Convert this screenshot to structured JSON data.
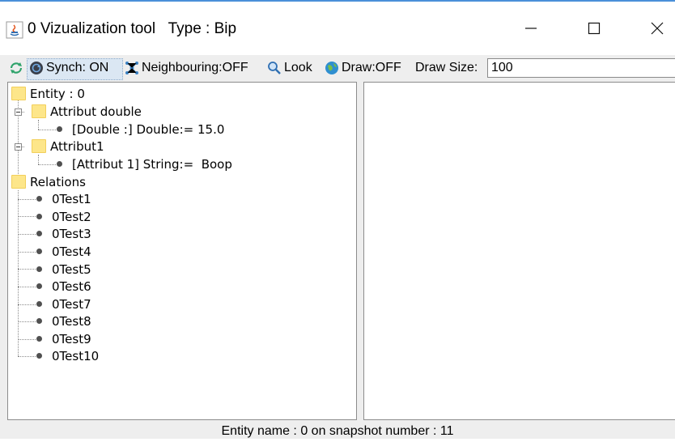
{
  "window": {
    "title": "0 Vizualization tool   Type : Bip",
    "minimize_icon": "minimize-icon",
    "maximize_icon": "maximize-icon",
    "close_icon": "close-icon"
  },
  "toolbar": {
    "synch_label": "Synch: ON",
    "neighbouring_label": "Neighbouring:OFF",
    "look_label": "Look",
    "draw_label": "Draw:OFF",
    "draw_size_label": "Draw Size:",
    "draw_size_value": "100"
  },
  "tree": {
    "root": "Entity : 0",
    "attr_double": "Attribut double",
    "attr_double_value": "[Double :] Double:= 15.0",
    "attr1": "Attribut1",
    "attr1_value": "[Attribut 1] String:=  Boop",
    "relations": "Relations",
    "relation_items": [
      "0Test1",
      "0Test2",
      "0Test3",
      "0Test4",
      "0Test5",
      "0Test6",
      "0Test7",
      "0Test8",
      "0Test9",
      "0Test10"
    ]
  },
  "status": {
    "text": "Entity name : 0 on snapshot number : 11"
  },
  "colors": {
    "accent": "#4a90d9",
    "folder": "#fde68a",
    "panel_bg": "#eeeeee"
  }
}
